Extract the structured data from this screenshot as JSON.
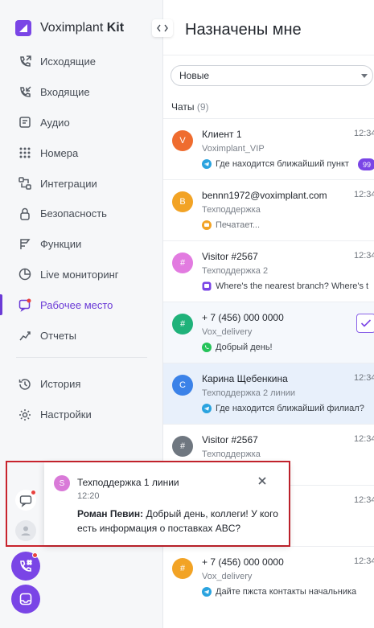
{
  "brand": {
    "name": "Voximplant",
    "name_bold": "Kit"
  },
  "collapse_label": "›‹",
  "nav": {
    "outgoing": "Исходящие",
    "incoming": "Входящие",
    "audio": "Аудио",
    "numbers": "Номера",
    "integrations": "Интеграции",
    "security": "Безопасность",
    "functions": "Функции",
    "live": "Live мониторинг",
    "workplace": "Рабочее место",
    "reports": "Отчеты",
    "history": "История",
    "settings": "Настройки"
  },
  "main": {
    "title": "Назначены мне",
    "filter_value": "Новые",
    "chats_label": "Чаты",
    "chats_count": "(9)"
  },
  "chats": [
    {
      "initial": "V",
      "color": "#ef6c2f",
      "name": "Клиент 1",
      "time": "12:34",
      "line": "Voximplant_VIP",
      "channel": "telegram",
      "message": "Где находится ближайший пункт",
      "badge": "99"
    },
    {
      "initial": "B",
      "color": "#f2a325",
      "name": "bennn1972@voximplant.com",
      "time": "12:34",
      "line": "Техподдержка",
      "channel": "widget",
      "message": "Печатает..."
    },
    {
      "initial": "#",
      "color": "#e27be0",
      "name": "Visitor #2567",
      "time": "12:34",
      "line": "Техподдержка 2",
      "channel": "viber",
      "message": "Where's the nearest branch? Where's t"
    },
    {
      "initial": "#",
      "color": "#1fb27a",
      "name": "+ 7 (456) 000 0000",
      "time": "",
      "line": "Vox_delivery",
      "channel": "whatsapp",
      "message": "Добрый день!"
    },
    {
      "initial": "C",
      "color": "#3b82e8",
      "name": "Карина Щебенкина",
      "time": "12:34",
      "line": "Техподдержка 2 линии",
      "channel": "telegram",
      "message": "Где находится ближайший филиал?"
    },
    {
      "initial": "#",
      "color": "#6f7780",
      "name": "Visitor #2567",
      "time": "12:34",
      "line": "Техподдержка",
      "channel": "",
      "message": ""
    },
    {
      "initial": "",
      "color": "#ffffff",
      "name": "",
      "time": "12:34",
      "line": "",
      "channel": "",
      "message": ""
    },
    {
      "initial": "#",
      "color": "#f2a325",
      "name": "+ 7 (456) 000 0000",
      "time": "12:34",
      "line": "Vox_delivery",
      "channel": "telegram",
      "message": "Дайте пжста контакты начальника"
    }
  ],
  "notification": {
    "initial": "S",
    "title": "Техподдержка 1 линии",
    "time": "12:20",
    "author": "Роман Певин:",
    "text": "Добрый день, коллеги! У кого есть информация о поставках ABC?"
  },
  "colors": {
    "accent": "#6b3bd6",
    "highlight_border": "#c8232d",
    "selected_row": "#e8f0fb"
  }
}
